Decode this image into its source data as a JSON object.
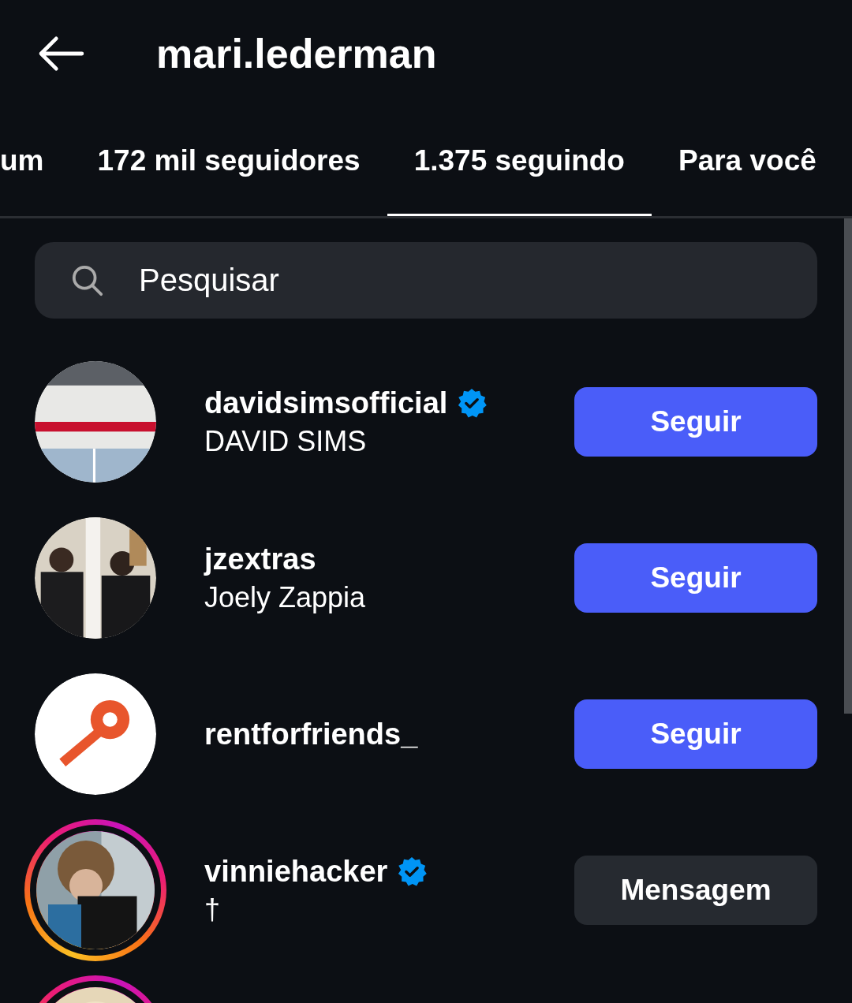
{
  "header": {
    "title": "mari.lederman"
  },
  "tabs": [
    {
      "label": "um",
      "selected": false
    },
    {
      "label": "172 mil seguidores",
      "selected": false
    },
    {
      "label": "1.375 seguindo",
      "selected": true
    },
    {
      "label": "Para você",
      "selected": false
    }
  ],
  "search": {
    "placeholder": "Pesquisar"
  },
  "users": [
    {
      "username": "davidsimsofficial",
      "verified": true,
      "full_name": "DAVID SIMS",
      "story_ring": false,
      "button": {
        "kind": "follow",
        "label": "Seguir"
      }
    },
    {
      "username": "jzextras",
      "verified": false,
      "full_name": "Joely Zappia",
      "story_ring": false,
      "button": {
        "kind": "follow",
        "label": "Seguir"
      }
    },
    {
      "username": "rentforfriends_",
      "verified": false,
      "story_ring": false,
      "button": {
        "kind": "follow",
        "label": "Seguir"
      }
    },
    {
      "username": "vinniehacker",
      "verified": true,
      "full_name": "†",
      "story_ring": true,
      "button": {
        "kind": "message",
        "label": "Mensagem"
      }
    },
    {
      "story_ring": true
    }
  ]
}
